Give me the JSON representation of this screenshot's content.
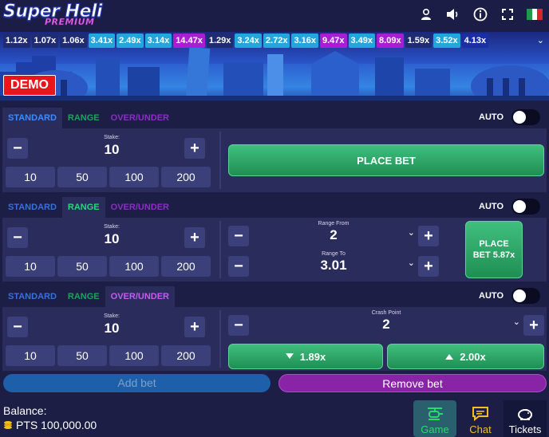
{
  "header": {
    "logo_main": "Super Heli",
    "logo_sub": "PREMIUM",
    "icons": [
      "user-icon",
      "volume-icon",
      "info-icon",
      "fullscreen-icon",
      "italy-flag-icon"
    ]
  },
  "multipliers": [
    {
      "v": "1.12x",
      "c": "dark"
    },
    {
      "v": "1.07x",
      "c": "dark"
    },
    {
      "v": "1.06x",
      "c": "dark"
    },
    {
      "v": "3.41x",
      "c": "blue"
    },
    {
      "v": "2.49x",
      "c": "blue"
    },
    {
      "v": "3.14x",
      "c": "blue"
    },
    {
      "v": "14.47x",
      "c": "purple"
    },
    {
      "v": "1.29x",
      "c": "dark"
    },
    {
      "v": "3.24x",
      "c": "blue"
    },
    {
      "v": "2.72x",
      "c": "blue"
    },
    {
      "v": "3.16x",
      "c": "blue"
    },
    {
      "v": "9.47x",
      "c": "purple"
    },
    {
      "v": "3.49x",
      "c": "blue"
    },
    {
      "v": "8.09x",
      "c": "purple"
    },
    {
      "v": "1.59x",
      "c": "dark"
    },
    {
      "v": "3.52x",
      "c": "blue"
    },
    {
      "v": "4.13x",
      "c": "navy"
    }
  ],
  "demo_label": "DEMO",
  "tabs": {
    "standard": "STANDARD",
    "range": "RANGE",
    "over_under": "OVER/UNDER"
  },
  "auto_label": "AUTO",
  "stake_label": "Stake:",
  "quick_amounts": [
    "10",
    "50",
    "100",
    "200"
  ],
  "bet1": {
    "stake": "10",
    "place_label": "PLACE BET"
  },
  "bet2": {
    "stake": "10",
    "range_from_label": "Range From",
    "range_from": "2",
    "range_to_label": "Range To",
    "range_to": "3.01",
    "place_line1": "PLACE",
    "place_line2": "BET 5.87x"
  },
  "bet3": {
    "stake": "10",
    "crash_label": "Crash Point",
    "crash_value": "2",
    "under_label": "1.89x",
    "over_label": "2.00x"
  },
  "add_bet": "Add bet",
  "remove_bet": "Remove bet",
  "balance_label": "Balance:",
  "balance_value": "PTS 100,000.00",
  "nav": {
    "game": "Game",
    "chat": "Chat",
    "tickets": "Tickets"
  },
  "colors": {
    "accent_green": "#2fb36b",
    "nav_active": "#2ad96e",
    "nav_chat": "#f2c01a",
    "purple": "#a81ed4"
  }
}
